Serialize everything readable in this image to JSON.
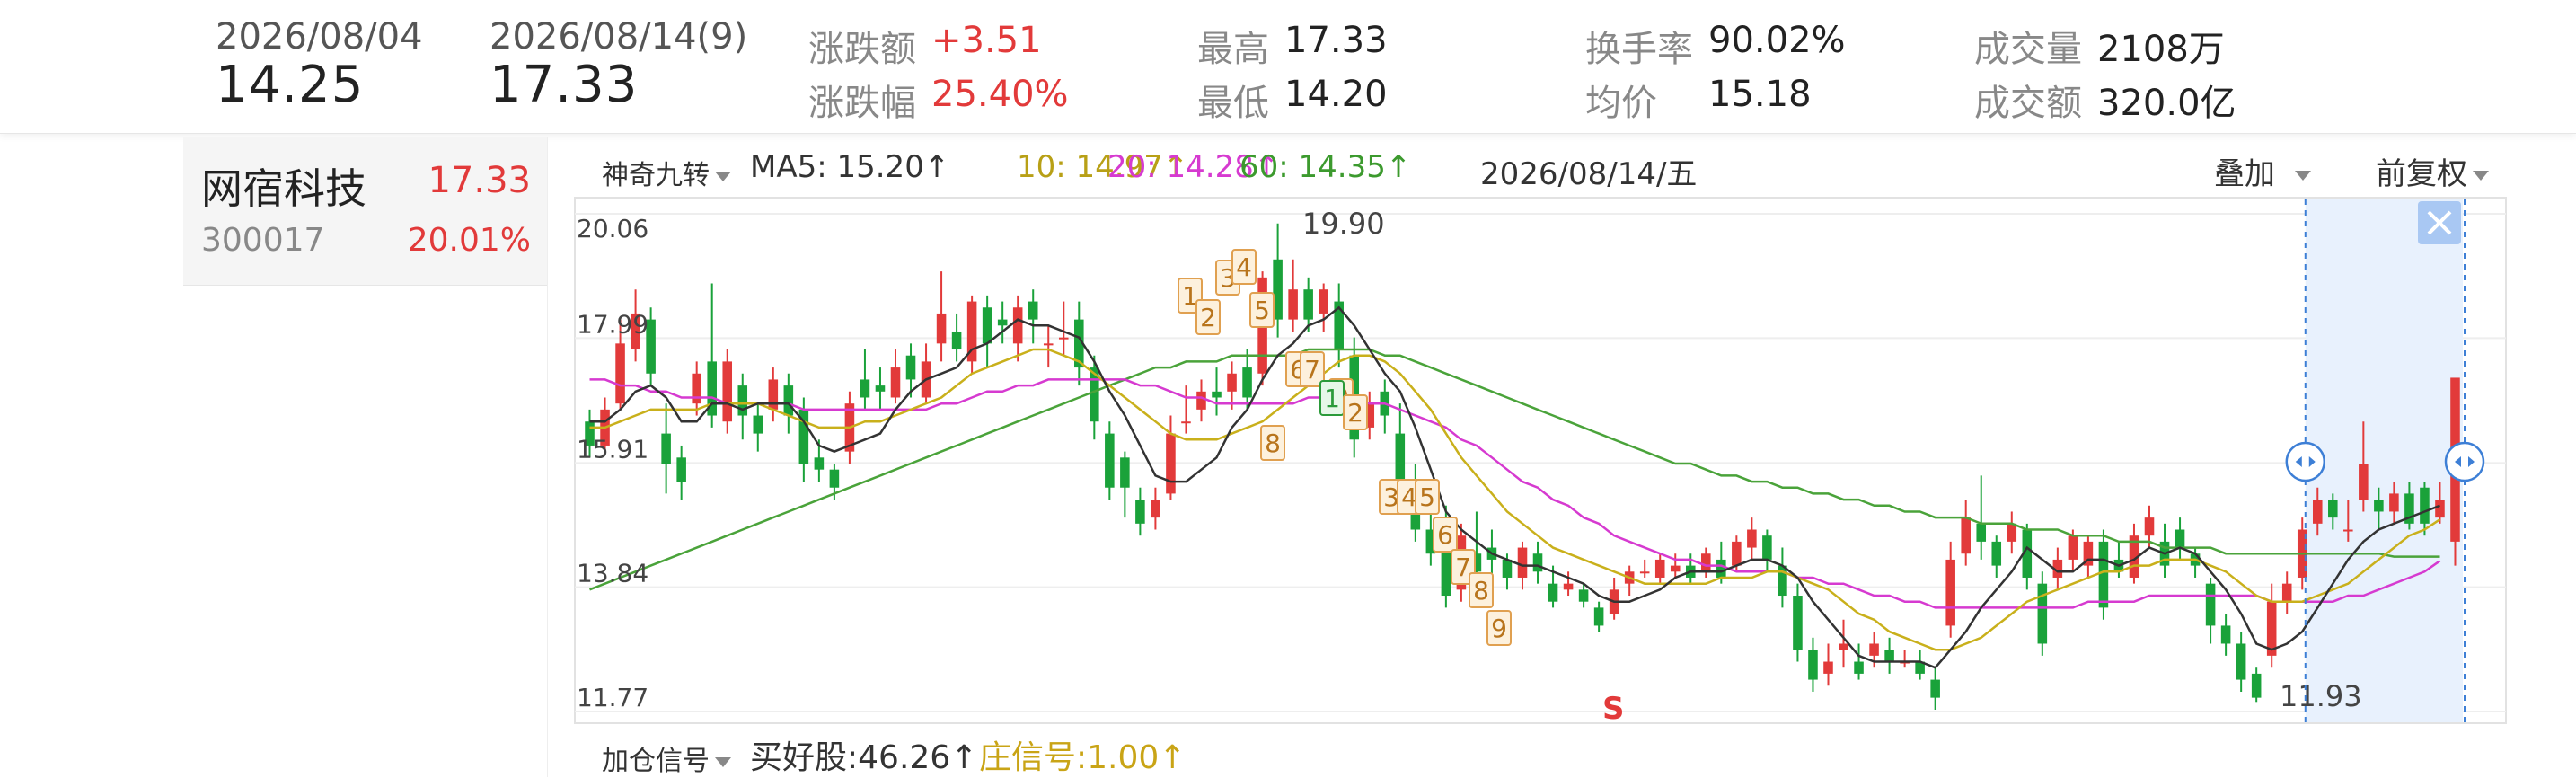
{
  "header": {
    "start_date": "2026/08/04",
    "start_price": "14.25",
    "end_date": "2026/08/14(9)",
    "end_price": "17.33",
    "change_amount_label": "涨跌额",
    "change_amount": "+3.51",
    "change_pct_label": "涨跌幅",
    "change_pct": "25.40%",
    "high_label": "最高",
    "high": "17.33",
    "low_label": "最低",
    "low": "14.20",
    "turnover_label": "换手率",
    "turnover": "90.02%",
    "avg_label": "均价",
    "avg": "15.18",
    "volume_label": "成交量",
    "volume": "2108万",
    "amount_label": "成交额",
    "amount": "320.0亿"
  },
  "stock": {
    "name": "网宿科技",
    "price": "17.33",
    "code": "300017",
    "pct": "20.01%"
  },
  "chart_header": {
    "indicator_select": "神奇九转",
    "ma5": "MA5: 15.20↑",
    "ma10": "10: 14.97↑",
    "ma20": "20: 14.28↑",
    "ma60": "60: 14.35↑",
    "date": "2026/08/14/五",
    "overlay": "叠加",
    "adjust": "前复权"
  },
  "chart_footer": {
    "indicator_select": "加仓信号",
    "buy_good": "买好股:46.26↑",
    "dealer_signal": "庄信号:1.00↑"
  },
  "colors": {
    "up": "#e23a3a",
    "down": "#1aa23a",
    "ma5": "#333333",
    "ma10": "#c9b01b",
    "ma20": "#d63ad0",
    "ma60": "#4aa33a",
    "selection": "#e8f1fd",
    "nine_turn": "#e0a050"
  },
  "chart_data": {
    "type": "candlestick",
    "y_ticks": [
      "20.06",
      "17.99",
      "15.91",
      "13.84",
      "11.77"
    ],
    "ylim": [
      11.77,
      20.06
    ],
    "high_label": "19.90",
    "low_label": "11.93",
    "sell_marker": "S",
    "nine_turn_labels": [
      "1",
      "2",
      "3",
      "4",
      "5",
      "6",
      "7",
      "8",
      "9",
      "1",
      "2",
      "3",
      "4",
      "5",
      "6",
      "7",
      "8",
      "9"
    ],
    "candles": [
      [
        16.6,
        16.2,
        16.8,
        16.0
      ],
      [
        16.2,
        16.8,
        17.0,
        16.1
      ],
      [
        16.9,
        17.9,
        18.3,
        16.8
      ],
      [
        17.8,
        18.4,
        18.8,
        17.6
      ],
      [
        18.3,
        17.4,
        18.5,
        17.2
      ],
      [
        16.4,
        15.9,
        16.9,
        15.4
      ],
      [
        16.0,
        15.6,
        16.2,
        15.3
      ],
      [
        16.9,
        17.4,
        17.6,
        16.7
      ],
      [
        17.6,
        16.7,
        18.9,
        16.5
      ],
      [
        16.6,
        17.6,
        17.8,
        16.4
      ],
      [
        17.2,
        16.7,
        17.4,
        16.3
      ],
      [
        16.7,
        16.4,
        16.9,
        16.1
      ],
      [
        16.8,
        17.3,
        17.5,
        16.6
      ],
      [
        17.2,
        16.7,
        17.4,
        16.4
      ],
      [
        16.8,
        15.9,
        17.0,
        15.6
      ],
      [
        16.0,
        15.8,
        16.3,
        15.6
      ],
      [
        15.8,
        15.5,
        15.9,
        15.3
      ],
      [
        16.1,
        16.9,
        17.1,
        15.9
      ],
      [
        17.3,
        17.0,
        17.8,
        16.8
      ],
      [
        17.2,
        17.1,
        17.5,
        16.8
      ],
      [
        17.0,
        17.5,
        17.8,
        16.9
      ],
      [
        17.7,
        17.3,
        17.9,
        17.0
      ],
      [
        17.0,
        17.6,
        17.9,
        16.9
      ],
      [
        17.9,
        18.4,
        19.1,
        17.6
      ],
      [
        18.1,
        17.8,
        18.4,
        17.6
      ],
      [
        17.6,
        18.6,
        18.7,
        17.4
      ],
      [
        18.5,
        17.9,
        18.7,
        17.5
      ],
      [
        18.3,
        18.2,
        18.6,
        17.9
      ],
      [
        17.9,
        18.5,
        18.7,
        17.6
      ],
      [
        18.6,
        18.3,
        18.8,
        17.9
      ],
      [
        17.9,
        17.9,
        18.2,
        17.5
      ],
      [
        18.0,
        18.0,
        18.6,
        17.7
      ],
      [
        18.3,
        17.5,
        18.6,
        17.2
      ],
      [
        17.5,
        16.6,
        17.7,
        16.3
      ],
      [
        16.4,
        15.5,
        16.6,
        15.3
      ],
      [
        16.0,
        15.5,
        16.1,
        15.0
      ],
      [
        15.3,
        14.9,
        15.5,
        14.7
      ],
      [
        15.0,
        15.3,
        15.5,
        14.8
      ],
      [
        15.4,
        16.4,
        16.7,
        15.3
      ],
      [
        16.6,
        16.6,
        17.2,
        16.4
      ],
      [
        16.8,
        17.1,
        17.3,
        16.6
      ],
      [
        17.1,
        17.0,
        17.5,
        16.7
      ],
      [
        17.1,
        17.4,
        17.6,
        16.8
      ],
      [
        17.5,
        17.0,
        17.8,
        16.8
      ],
      [
        17.4,
        19.0,
        19.1,
        17.2
      ],
      [
        19.3,
        18.3,
        19.9,
        18.0
      ],
      [
        18.3,
        18.8,
        19.3,
        18.1
      ],
      [
        18.8,
        18.3,
        19.0,
        18.1
      ],
      [
        18.4,
        18.8,
        18.9,
        18.1
      ],
      [
        18.6,
        17.8,
        18.9,
        17.5
      ],
      [
        17.7,
        16.3,
        18.0,
        16.0
      ],
      [
        16.5,
        16.9,
        17.1,
        16.3
      ],
      [
        17.1,
        16.7,
        17.3,
        16.4
      ],
      [
        16.4,
        15.6,
        16.9,
        15.4
      ],
      [
        15.6,
        14.8,
        15.9,
        14.6
      ],
      [
        14.8,
        14.4,
        15.3,
        14.2
      ],
      [
        14.8,
        13.7,
        15.2,
        13.5
      ],
      [
        13.8,
        14.7,
        14.9,
        13.6
      ],
      [
        14.4,
        14.1,
        15.1,
        13.8
      ],
      [
        14.5,
        14.3,
        14.8,
        14.0
      ],
      [
        14.3,
        14.0,
        14.4,
        13.8
      ],
      [
        14.0,
        14.5,
        14.6,
        13.8
      ],
      [
        14.4,
        14.1,
        14.6,
        13.9
      ],
      [
        13.9,
        13.6,
        14.2,
        13.5
      ],
      [
        13.8,
        13.9,
        14.1,
        13.7
      ],
      [
        13.8,
        13.6,
        13.9,
        13.5
      ],
      [
        13.5,
        13.2,
        13.6,
        13.1
      ],
      [
        13.4,
        13.8,
        14.0,
        13.3
      ],
      [
        13.9,
        14.1,
        14.2,
        13.7
      ],
      [
        14.1,
        14.1,
        14.3,
        14.0
      ],
      [
        14.0,
        14.3,
        14.4,
        13.9
      ],
      [
        14.1,
        14.2,
        14.4,
        14.0
      ],
      [
        14.2,
        14.0,
        14.4,
        13.9
      ],
      [
        14.1,
        14.4,
        14.5,
        14.0
      ],
      [
        14.3,
        14.0,
        14.6,
        13.9
      ],
      [
        14.2,
        14.6,
        14.7,
        14.1
      ],
      [
        14.5,
        14.8,
        15.0,
        14.3
      ],
      [
        14.7,
        14.3,
        14.8,
        14.1
      ],
      [
        14.2,
        13.7,
        14.5,
        13.5
      ],
      [
        13.7,
        12.8,
        13.9,
        12.6
      ],
      [
        12.8,
        12.3,
        13.0,
        12.1
      ],
      [
        12.4,
        12.6,
        12.9,
        12.2
      ],
      [
        12.8,
        12.9,
        13.3,
        12.5
      ],
      [
        12.6,
        12.4,
        12.9,
        12.3
      ],
      [
        12.7,
        12.9,
        13.1,
        12.5
      ],
      [
        12.8,
        12.6,
        13.0,
        12.4
      ],
      [
        12.6,
        12.6,
        12.8,
        12.5
      ],
      [
        12.6,
        12.4,
        12.8,
        12.3
      ],
      [
        12.3,
        12.0,
        12.5,
        11.8
      ],
      [
        13.2,
        14.3,
        14.6,
        13.0
      ],
      [
        14.4,
        15.0,
        15.3,
        14.2
      ],
      [
        14.9,
        14.6,
        15.7,
        14.3
      ],
      [
        14.6,
        14.2,
        14.7,
        14.0
      ],
      [
        14.6,
        14.9,
        15.1,
        14.4
      ],
      [
        14.8,
        14.0,
        14.9,
        13.8
      ],
      [
        13.9,
        12.9,
        14.1,
        12.7
      ],
      [
        14.0,
        14.3,
        14.5,
        13.8
      ],
      [
        14.3,
        14.7,
        14.8,
        14.1
      ],
      [
        14.2,
        14.6,
        14.7,
        14.0
      ],
      [
        14.6,
        13.5,
        14.8,
        13.3
      ],
      [
        14.3,
        14.1,
        14.6,
        14.0
      ],
      [
        14.0,
        14.7,
        14.9,
        13.9
      ],
      [
        14.7,
        15.0,
        15.2,
        14.5
      ],
      [
        14.6,
        14.2,
        14.9,
        14.0
      ],
      [
        14.8,
        14.5,
        15.0,
        14.3
      ],
      [
        14.4,
        14.2,
        14.5,
        14.0
      ],
      [
        13.9,
        13.2,
        14.0,
        12.9
      ],
      [
        13.2,
        12.9,
        13.4,
        12.7
      ],
      [
        12.9,
        12.3,
        13.1,
        12.1
      ],
      [
        12.4,
        12.0,
        12.5,
        11.93
      ],
      [
        12.7,
        13.6,
        13.9,
        12.5
      ],
      [
        13.6,
        13.9,
        14.1,
        13.4
      ],
      [
        14.0,
        14.8,
        15.0,
        13.8
      ],
      [
        14.9,
        15.3,
        15.5,
        14.7
      ],
      [
        15.3,
        15.0,
        15.4,
        14.8
      ],
      [
        14.8,
        14.8,
        15.3,
        14.6
      ],
      [
        15.3,
        15.9,
        16.6,
        15.1
      ],
      [
        15.3,
        15.1,
        15.5,
        14.8
      ],
      [
        15.1,
        15.4,
        15.6,
        14.9
      ],
      [
        15.4,
        14.9,
        15.6,
        14.8
      ],
      [
        15.5,
        14.9,
        15.6,
        14.7
      ],
      [
        15.0,
        15.3,
        15.6,
        14.9
      ],
      [
        14.6,
        17.33,
        17.33,
        14.2
      ]
    ],
    "ma5": [
      16.6,
      16.6,
      16.8,
      17.1,
      17.2,
      17.0,
      16.6,
      16.6,
      16.9,
      16.9,
      16.8,
      16.9,
      16.9,
      16.9,
      16.6,
      16.2,
      16.1,
      16.2,
      16.3,
      16.4,
      16.8,
      17.1,
      17.3,
      17.4,
      17.5,
      17.8,
      17.9,
      18.1,
      18.3,
      18.2,
      18.2,
      18.1,
      18.0,
      17.6,
      17.1,
      16.7,
      16.2,
      15.7,
      15.6,
      15.6,
      15.8,
      16.0,
      16.5,
      16.8,
      17.3,
      17.7,
      17.9,
      18.2,
      18.3,
      18.5,
      18.2,
      17.8,
      17.4,
      17.1,
      16.5,
      15.8,
      15.1,
      14.8,
      14.6,
      14.4,
      14.3,
      14.2,
      14.2,
      14.1,
      14.0,
      13.9,
      13.7,
      13.6,
      13.6,
      13.7,
      13.8,
      14.0,
      14.1,
      14.1,
      14.1,
      14.2,
      14.3,
      14.3,
      14.2,
      14.0,
      13.6,
      13.3,
      13.0,
      12.7,
      12.6,
      12.6,
      12.6,
      12.6,
      12.5,
      12.8,
      13.1,
      13.5,
      13.8,
      14.1,
      14.5,
      14.3,
      14.1,
      14.1,
      14.3,
      14.3,
      14.2,
      14.3,
      14.5,
      14.4,
      14.5,
      14.4,
      14.1,
      13.8,
      13.4,
      12.9,
      12.8,
      12.9,
      13.1,
      13.5,
      13.9,
      14.3,
      14.6,
      14.8,
      14.9,
      15.0,
      15.1,
      15.2
    ],
    "ma10": [
      16.5,
      16.5,
      16.6,
      16.7,
      16.8,
      16.8,
      16.8,
      16.8,
      16.9,
      16.9,
      16.9,
      16.9,
      16.8,
      16.7,
      16.6,
      16.5,
      16.5,
      16.5,
      16.6,
      16.6,
      16.7,
      16.8,
      16.9,
      17.0,
      17.2,
      17.4,
      17.5,
      17.6,
      17.7,
      17.8,
      17.8,
      17.7,
      17.6,
      17.4,
      17.2,
      17.0,
      16.8,
      16.6,
      16.4,
      16.3,
      16.3,
      16.3,
      16.4,
      16.5,
      16.6,
      16.8,
      17.0,
      17.2,
      17.4,
      17.6,
      17.7,
      17.7,
      17.6,
      17.4,
      17.1,
      16.8,
      16.4,
      16.0,
      15.7,
      15.4,
      15.1,
      14.9,
      14.7,
      14.5,
      14.4,
      14.3,
      14.2,
      14.1,
      14.0,
      13.9,
      13.9,
      13.9,
      13.9,
      13.9,
      14.0,
      14.0,
      14.0,
      14.1,
      14.1,
      14.0,
      13.9,
      13.8,
      13.6,
      13.4,
      13.3,
      13.1,
      13.0,
      12.9,
      12.8,
      12.8,
      12.9,
      13.0,
      13.2,
      13.4,
      13.6,
      13.7,
      13.8,
      13.9,
      14.0,
      14.1,
      14.1,
      14.2,
      14.2,
      14.3,
      14.3,
      14.3,
      14.2,
      14.1,
      13.9,
      13.7,
      13.6,
      13.6,
      13.6,
      13.7,
      13.8,
      13.9,
      14.1,
      14.3,
      14.5,
      14.7,
      14.8,
      14.97
    ],
    "ma20": [
      17.3,
      17.3,
      17.2,
      17.2,
      17.1,
      17.1,
      17.0,
      17.0,
      17.0,
      16.9,
      16.9,
      16.9,
      16.9,
      16.9,
      16.8,
      16.8,
      16.8,
      16.8,
      16.8,
      16.8,
      16.8,
      16.8,
      16.8,
      16.9,
      16.9,
      17.0,
      17.1,
      17.1,
      17.2,
      17.2,
      17.3,
      17.3,
      17.3,
      17.3,
      17.3,
      17.3,
      17.2,
      17.2,
      17.1,
      17.0,
      17.0,
      16.9,
      16.9,
      16.9,
      16.9,
      16.9,
      16.9,
      17.0,
      17.0,
      17.0,
      17.0,
      16.9,
      16.9,
      16.8,
      16.7,
      16.6,
      16.5,
      16.3,
      16.2,
      16.0,
      15.8,
      15.6,
      15.5,
      15.3,
      15.2,
      15.0,
      14.9,
      14.7,
      14.6,
      14.5,
      14.4,
      14.3,
      14.3,
      14.2,
      14.2,
      14.1,
      14.1,
      14.1,
      14.1,
      14.0,
      14.0,
      13.9,
      13.9,
      13.8,
      13.7,
      13.7,
      13.6,
      13.6,
      13.5,
      13.5,
      13.5,
      13.5,
      13.5,
      13.5,
      13.5,
      13.5,
      13.5,
      13.5,
      13.6,
      13.6,
      13.6,
      13.6,
      13.7,
      13.7,
      13.7,
      13.7,
      13.7,
      13.7,
      13.7,
      13.7,
      13.6,
      13.6,
      13.6,
      13.6,
      13.6,
      13.7,
      13.7,
      13.8,
      13.9,
      14.0,
      14.1,
      14.28
    ],
    "ma60": [
      13.8,
      13.9,
      14.0,
      14.1,
      14.2,
      14.3,
      14.4,
      14.5,
      14.6,
      14.7,
      14.8,
      14.9,
      15.0,
      15.1,
      15.2,
      15.3,
      15.4,
      15.5,
      15.6,
      15.7,
      15.8,
      15.9,
      16.0,
      16.1,
      16.2,
      16.3,
      16.4,
      16.5,
      16.6,
      16.7,
      16.8,
      16.9,
      17.0,
      17.1,
      17.2,
      17.3,
      17.4,
      17.5,
      17.5,
      17.6,
      17.6,
      17.6,
      17.7,
      17.7,
      17.7,
      17.7,
      17.7,
      17.8,
      17.8,
      17.8,
      17.8,
      17.8,
      17.7,
      17.7,
      17.6,
      17.5,
      17.4,
      17.3,
      17.2,
      17.1,
      17.0,
      16.9,
      16.8,
      16.7,
      16.6,
      16.5,
      16.4,
      16.3,
      16.2,
      16.1,
      16.0,
      15.9,
      15.9,
      15.8,
      15.7,
      15.7,
      15.6,
      15.6,
      15.5,
      15.5,
      15.4,
      15.4,
      15.3,
      15.3,
      15.2,
      15.2,
      15.1,
      15.1,
      15.0,
      15.0,
      15.0,
      14.9,
      14.9,
      14.9,
      14.8,
      14.8,
      14.8,
      14.7,
      14.7,
      14.7,
      14.6,
      14.6,
      14.6,
      14.5,
      14.5,
      14.5,
      14.5,
      14.4,
      14.4,
      14.4,
      14.4,
      14.4,
      14.4,
      14.4,
      14.4,
      14.4,
      14.4,
      14.4,
      14.35,
      14.35,
      14.35,
      14.35
    ]
  }
}
